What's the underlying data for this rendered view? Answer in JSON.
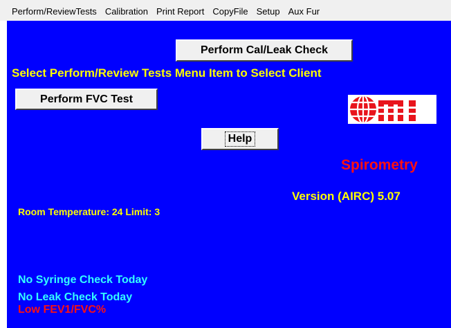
{
  "menu": {
    "items": [
      "Perform/ReviewTests",
      "Calibration",
      "Print Report",
      "CopyFile",
      "Setup",
      "Aux Fur"
    ]
  },
  "buttons": {
    "cal_leak": "Perform Cal/Leak Check",
    "fvc": "Perform FVC Test",
    "help": "Help"
  },
  "main": {
    "instruction": "Select Perform/Review Tests Menu Item to Select Client",
    "logo_text": "OMI",
    "product": "Spirometry",
    "version": "Version (AIRC)  5.07",
    "room_temperature": "Room Temperature: 24 Limit: 3"
  },
  "status": {
    "syringe": "No Syringe Check Today",
    "leak": "No Leak Check Today",
    "fev": "Low FEV1/FVC%"
  },
  "colors": {
    "background": "#0000ff",
    "menubar": "#f0f0f0",
    "instruction_text": "#ffff00",
    "product_text": "#ff1010",
    "status_cyan": "#33ffff",
    "status_red": "#ff1010",
    "logo_red": "#e8141c"
  }
}
